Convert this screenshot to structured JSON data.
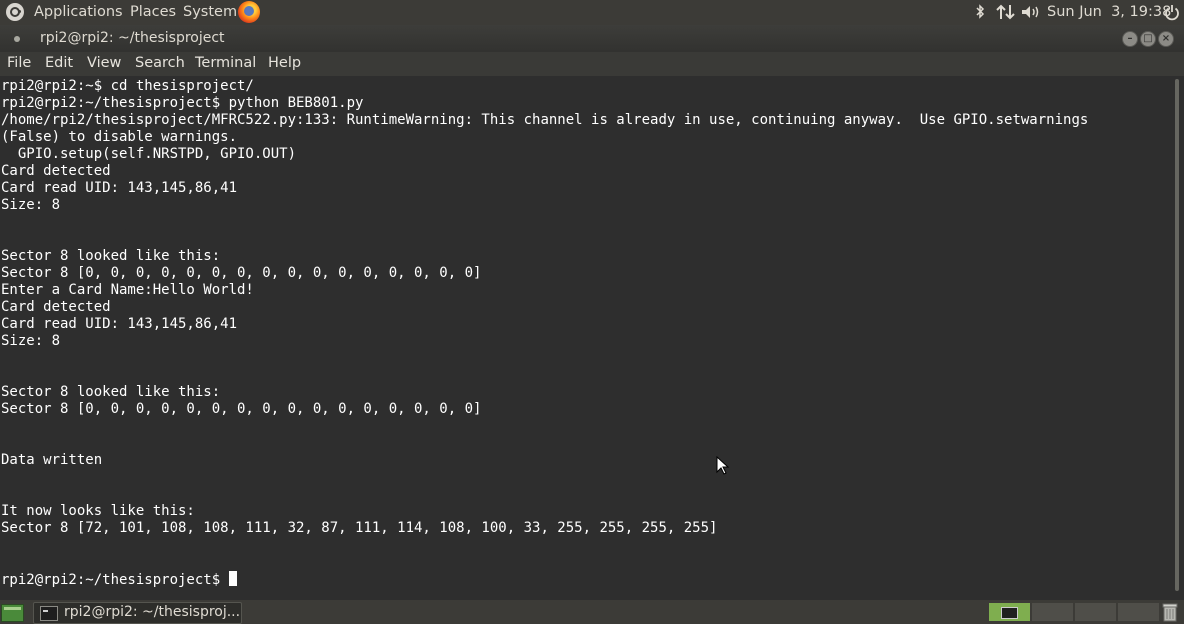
{
  "top_panel": {
    "menus": [
      "Applications",
      "Places",
      "System"
    ],
    "clock": "Sun Jun  3, 19:38"
  },
  "window": {
    "title": "rpi2@rpi2: ~/thesisproject",
    "menu": [
      "File",
      "Edit",
      "View",
      "Search",
      "Terminal",
      "Help"
    ]
  },
  "terminal": {
    "lines": [
      "rpi2@rpi2:~$ cd thesisproject/",
      "rpi2@rpi2:~/thesisproject$ python BEB801.py",
      "/home/rpi2/thesisproject/MFRC522.py:133: RuntimeWarning: This channel is already in use, continuing anyway.  Use GPIO.setwarnings",
      "(False) to disable warnings.",
      "  GPIO.setup(self.NRSTPD, GPIO.OUT)",
      "Card detected",
      "Card read UID: 143,145,86,41",
      "Size: 8",
      "",
      "",
      "Sector 8 looked like this:",
      "Sector 8 [0, 0, 0, 0, 0, 0, 0, 0, 0, 0, 0, 0, 0, 0, 0, 0]",
      "Enter a Card Name:Hello World!",
      "Card detected",
      "Card read UID: 143,145,86,41",
      "Size: 8",
      "",
      "",
      "Sector 8 looked like this:",
      "Sector 8 [0, 0, 0, 0, 0, 0, 0, 0, 0, 0, 0, 0, 0, 0, 0, 0]",
      "",
      "",
      "Data written",
      "",
      "",
      "It now looks like this:",
      "Sector 8 [72, 101, 108, 108, 111, 32, 87, 111, 114, 108, 100, 33, 255, 255, 255, 255]",
      "",
      ""
    ],
    "prompt": "rpi2@rpi2:~/thesisproject$ "
  },
  "taskbar": {
    "task_label": "rpi2@rpi2: ~/thesisproj..."
  }
}
